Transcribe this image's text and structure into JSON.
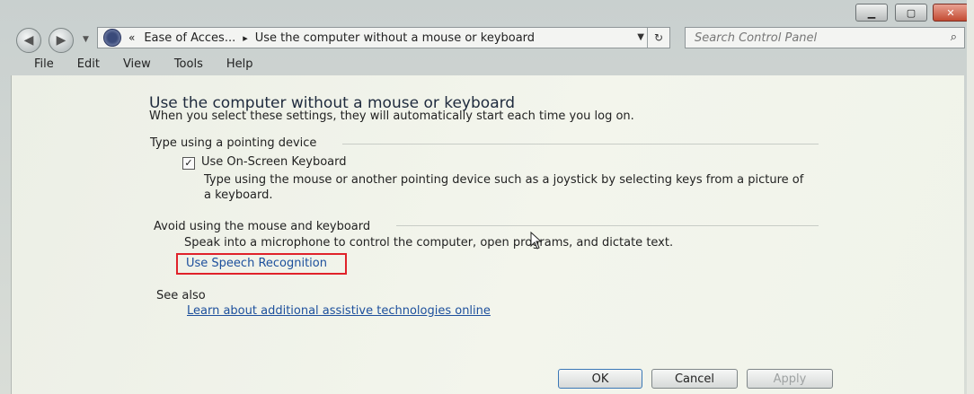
{
  "address": {
    "crumb_prefix": "«",
    "crumb_root": "Ease of Acces...",
    "crumb_sep": "▸",
    "crumb_current": "Use the computer without a mouse or keyboard"
  },
  "search": {
    "placeholder": "Search Control Panel"
  },
  "menu": [
    "File",
    "Edit",
    "View",
    "Tools",
    "Help"
  ],
  "page": {
    "title": "Use the computer without a mouse or keyboard",
    "subtitle": "When you select these settings, they will automatically start each time you log on."
  },
  "section_pointing": {
    "heading": "Type using a pointing device",
    "checkbox_label": "Use On-Screen Keyboard",
    "checkbox_checked": true,
    "description_line1": "Type using the mouse or another pointing device such as a joystick by selecting keys from a picture of",
    "description_line2": "a keyboard."
  },
  "section_avoid": {
    "heading": "Avoid using the mouse and keyboard",
    "description": "Speak into a microphone to control the computer, open programs, and dictate text.",
    "link": "Use Speech Recognition"
  },
  "see_also": {
    "heading": "See also",
    "link": "Learn about additional assistive technologies online"
  },
  "buttons": {
    "ok": "OK",
    "cancel": "Cancel",
    "apply": "Apply"
  },
  "colors": {
    "link": "#1c4f9c",
    "highlight": "#e0222a",
    "close_button": "#c34b32"
  }
}
